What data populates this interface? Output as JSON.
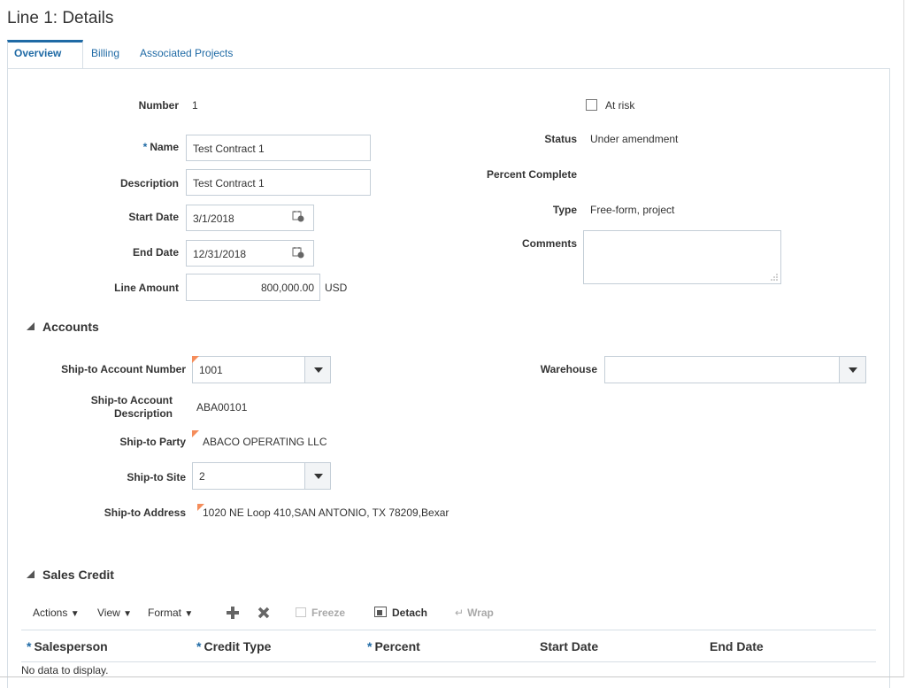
{
  "page": {
    "title": "Line 1: Details"
  },
  "tabs": [
    {
      "label": "Overview",
      "active": true
    },
    {
      "label": "Billing",
      "active": false
    },
    {
      "label": "Associated Projects",
      "active": false
    }
  ],
  "overview": {
    "number_label": "Number",
    "number_value": "1",
    "name_label": "Name",
    "name_value": "Test Contract 1",
    "description_label": "Description",
    "description_value": "Test Contract 1",
    "start_date_label": "Start Date",
    "start_date_value": "3/1/2018",
    "end_date_label": "End Date",
    "end_date_value": "12/31/2018",
    "line_amount_label": "Line Amount",
    "line_amount_value": "800,000.00",
    "currency": "USD",
    "at_risk_label": "At risk",
    "status_label": "Status",
    "status_value": "Under amendment",
    "percent_complete_label": "Percent Complete",
    "type_label": "Type",
    "type_value": "Free-form, project",
    "comments_label": "Comments",
    "comments_value": ""
  },
  "accounts": {
    "header": "Accounts",
    "ship_to_account_number_label": "Ship-to Account Number",
    "ship_to_account_number_value": "1001",
    "warehouse_label": "Warehouse",
    "warehouse_value": "",
    "ship_to_account_desc_label_1": "Ship-to Account",
    "ship_to_account_desc_label_2": "Description",
    "ship_to_account_desc_value": "ABA00101",
    "ship_to_party_label": "Ship-to Party",
    "ship_to_party_value": "ABACO OPERATING LLC",
    "ship_to_site_label": "Ship-to Site",
    "ship_to_site_value": "2",
    "ship_to_address_label": "Ship-to Address",
    "ship_to_address_value": "1020 NE Loop 410,SAN ANTONIO, TX 78209,Bexar"
  },
  "sales_credit": {
    "header": "Sales Credit",
    "toolbar": {
      "actions": "Actions",
      "view": "View",
      "format": "Format",
      "freeze": "Freeze",
      "detach": "Detach",
      "wrap": "Wrap"
    },
    "columns": [
      "Salesperson",
      "Credit Type",
      "Percent",
      "Start Date",
      "End Date"
    ],
    "empty_text": "No data to display."
  },
  "colors": {
    "accent": "#1f6aa5",
    "flag": "#f58d5b",
    "border": "#c4ced7"
  }
}
